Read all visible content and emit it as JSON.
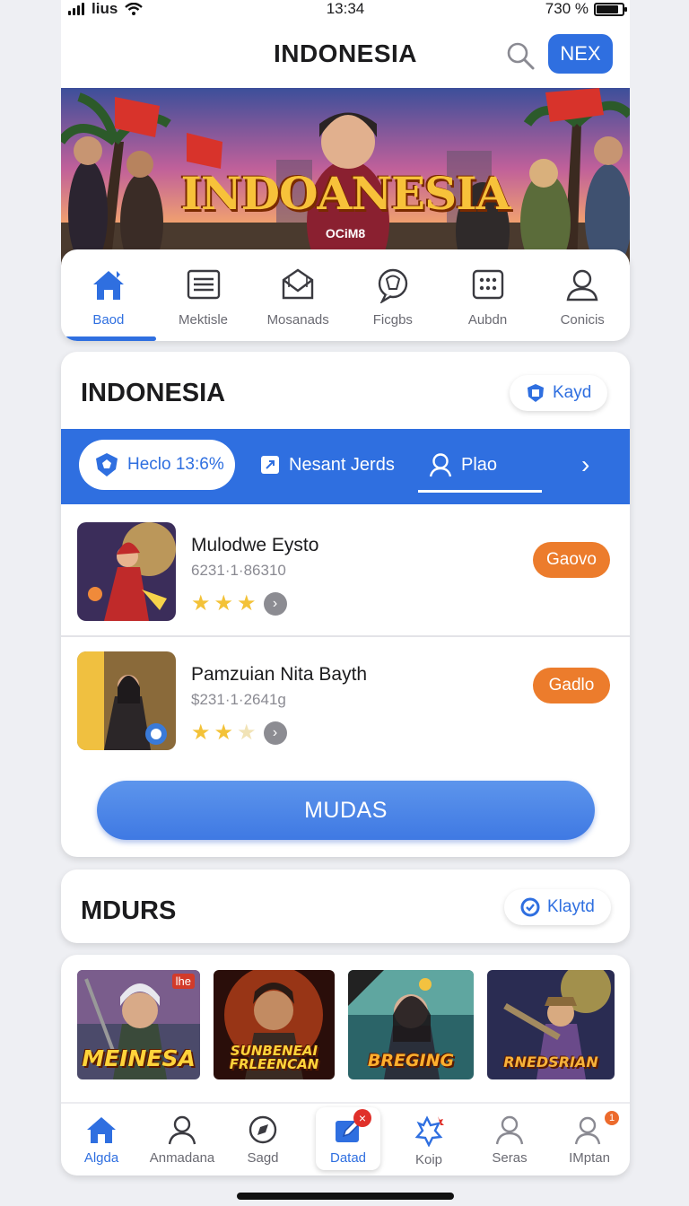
{
  "status_bar": {
    "carrier": "lius",
    "time": "13:34",
    "battery": "730 %",
    "battery_level": 0.85
  },
  "header": {
    "title": "INDONESIA",
    "action_button": "NEX"
  },
  "banner": {
    "title": "INDOANESIA",
    "subtitle": "OCiM8"
  },
  "categories": [
    {
      "label": "Baod",
      "icon": "home-icon",
      "active": true
    },
    {
      "label": "Mektisle",
      "icon": "list-icon"
    },
    {
      "label": "Mosanads",
      "icon": "envelope-icon"
    },
    {
      "label": "Ficgbs",
      "icon": "chat-bubble-icon"
    },
    {
      "label": "Aubdn",
      "icon": "grid-icon"
    },
    {
      "label": "Conicis",
      "icon": "user-icon"
    }
  ],
  "section1": {
    "title": "INDONESIA",
    "pill": "Kayd",
    "tabs": [
      {
        "label": "Heclo 13:6%",
        "active": true
      },
      {
        "label": "Nesant Jerds"
      },
      {
        "label": "Plao"
      }
    ],
    "items": [
      {
        "name": "Mulodwe Eysto",
        "sub": "6231·1·86310",
        "rating": 3,
        "button": "Gaovo"
      },
      {
        "name": "Pamzuian Nita Bayth",
        "sub": "$231·1·2641g",
        "rating": 2,
        "button": "Gadlo"
      }
    ],
    "main_button": "MUDAS"
  },
  "section2": {
    "title": "MDURS",
    "pill": "Klaytd"
  },
  "games": [
    {
      "title": "MEINESA",
      "badge": "lhe"
    },
    {
      "title": "SUNBENEAI FRLEENCAN"
    },
    {
      "title": "BREGING"
    },
    {
      "title": "RNEDSRIAN"
    }
  ],
  "bottom_nav": [
    {
      "label": "Algda",
      "icon": "home-icon",
      "active": true
    },
    {
      "label": "Anmadana",
      "icon": "person-icon"
    },
    {
      "label": "Sagd",
      "icon": "compass-icon"
    },
    {
      "label": "Datad",
      "icon": "edit-icon",
      "badge": "×"
    },
    {
      "label": "Koip",
      "icon": "star-burst-icon"
    },
    {
      "label": "Seras",
      "icon": "person-icon"
    },
    {
      "label": "IMptan",
      "icon": "profile-icon",
      "badge": "1"
    }
  ],
  "colors": {
    "accent": "#2f6fe0",
    "orange": "#ec7c2c",
    "background": "#eeeff3"
  }
}
